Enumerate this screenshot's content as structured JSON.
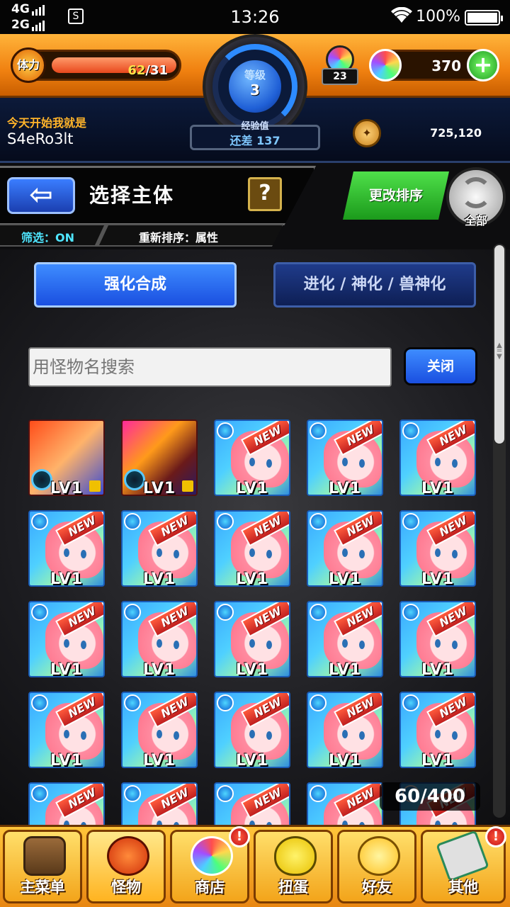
{
  "status_bar": {
    "net1": "4G",
    "net2": "2G",
    "sim": "S",
    "time": "13:26",
    "battery": "100%"
  },
  "header": {
    "stamina_label": "体力",
    "stamina_current": "62",
    "stamina_max": "/31",
    "level_label": "等级",
    "level_value": "3",
    "exp_label": "经验值",
    "exp_text": "还差 137",
    "orb_count": "23",
    "gems": "370",
    "plus": "+",
    "user_message": "今天开始我就是",
    "user_name": "S4eRo3lt",
    "coins": "725,120"
  },
  "title_bar": {
    "back": "⇦",
    "title": "选择主体",
    "help": "?",
    "filter": "筛选：ON",
    "sort": "重新排序：属性",
    "change_sort": "更改排序",
    "all": "全部"
  },
  "tabs": {
    "enhance": "强化合成",
    "evolve": "进化 / 神化 / 兽神化"
  },
  "search": {
    "placeholder": "用怪物名搜索",
    "close": "关闭"
  },
  "grid": {
    "cell_level": "LV1",
    "new_badge": "NEW",
    "box_count": "60/400"
  },
  "nav": {
    "main_menu": "主菜单",
    "monster": "怪物",
    "shop": "商店",
    "gacha": "扭蛋",
    "friends": "好友",
    "other": "其他",
    "badge": "!"
  },
  "colors": {
    "accent_orange": "#f08010",
    "accent_blue": "#1a4fe0",
    "green": "#1b9a1b"
  }
}
